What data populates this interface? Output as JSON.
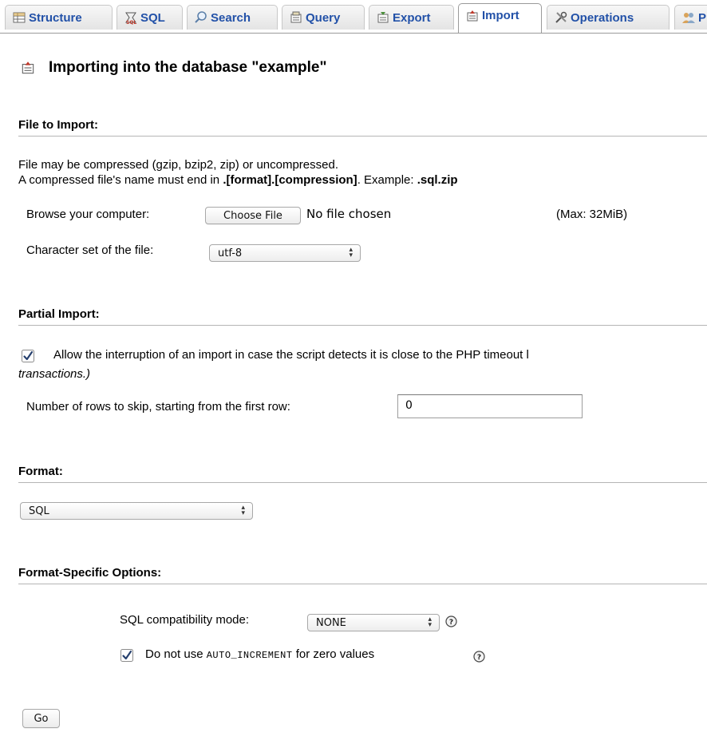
{
  "tabs": [
    {
      "label": "Structure",
      "icon": "structure-icon"
    },
    {
      "label": "SQL",
      "icon": "sql-icon"
    },
    {
      "label": "Search",
      "icon": "search-icon"
    },
    {
      "label": "Query",
      "icon": "query-icon"
    },
    {
      "label": "Export",
      "icon": "export-icon"
    },
    {
      "label": "Import",
      "icon": "import-icon",
      "active": true
    },
    {
      "label": "Operations",
      "icon": "operations-icon"
    },
    {
      "label": "P",
      "icon": "privileges-icon"
    }
  ],
  "page": {
    "title": "Importing into the database \"example\""
  },
  "file_to_import": {
    "heading": "File to Import:",
    "line1": "File may be compressed (gzip, bzip2, zip) or uncompressed.",
    "line2_prefix": "A compressed file's name must end in ",
    "line2_format": ".[format].[compression]",
    "line2_middle": ". Example: ",
    "line2_example": ".sql.zip",
    "browse_label": "Browse your computer:",
    "choose_file_button": "Choose File",
    "no_file_text": "No file chosen",
    "max_size": "(Max: 32MiB)",
    "charset_label": "Character set of the file:",
    "charset_value": "utf-8"
  },
  "partial_import": {
    "heading": "Partial Import:",
    "allow_interrupt_checked": true,
    "allow_interrupt_text": "Allow the interruption of an import in case the script detects it is close to the PHP timeout l",
    "allow_interrupt_text_cont": "transactions.)",
    "skip_rows_label": "Number of rows to skip, starting from the first row:",
    "skip_rows_value": "0"
  },
  "format": {
    "heading": "Format:",
    "value": "SQL"
  },
  "format_options": {
    "heading": "Format-Specific Options:",
    "compat_label": "SQL compatibility mode:",
    "compat_value": "NONE",
    "auto_inc_checked": true,
    "auto_inc_prefix": "Do not use ",
    "auto_inc_code": "AUTO_INCREMENT",
    "auto_inc_suffix": " for zero values"
  },
  "actions": {
    "go_button": "Go"
  }
}
